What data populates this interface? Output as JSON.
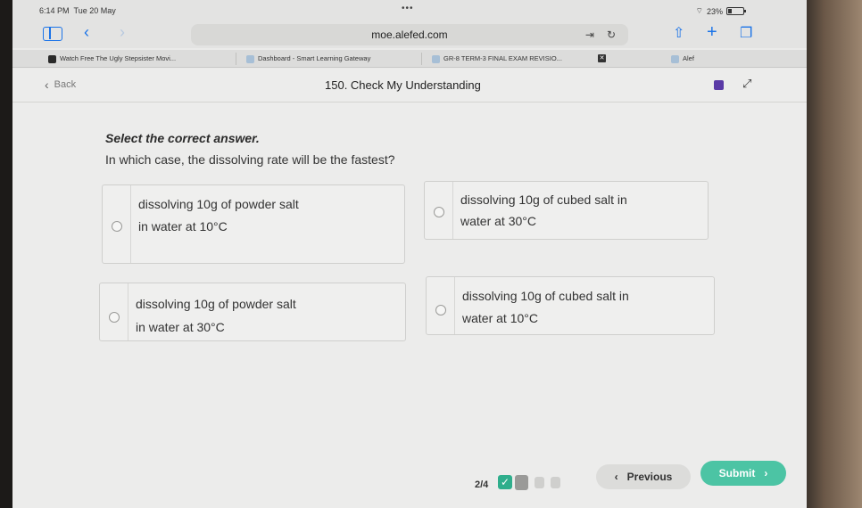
{
  "status_bar": {
    "time": "6:14 PM",
    "date": "Tue 20 May",
    "battery": "23%"
  },
  "browser": {
    "url": "moe.alefed.com",
    "tabs": [
      {
        "label": "Watch Free The Ugly Stepsister Movi..."
      },
      {
        "label": "Dashboard - Smart Learning Gateway"
      },
      {
        "label": "GR-8 TERM-3 FINAL EXAM REVISIO..."
      },
      {
        "label": "Alef"
      }
    ]
  },
  "header": {
    "back_label": "Back",
    "title": "150. Check My Understanding"
  },
  "question": {
    "instruction": "Select the correct answer.",
    "text": "In which case, the dissolving rate will be the fastest?",
    "options": [
      {
        "line1": "dissolving 10g of powder salt",
        "line2": "in water at 10°C"
      },
      {
        "line1": "dissolving 10g of cubed salt in",
        "line2": "water at 30°C"
      },
      {
        "line1": "dissolving 10g of powder salt",
        "line2": "in water at 30°C"
      },
      {
        "line1": "dissolving 10g of cubed salt in",
        "line2": "water at 10°C"
      }
    ]
  },
  "footer": {
    "progress": "2/4",
    "previous_label": "Previous",
    "submit_label": "Submit"
  },
  "colors": {
    "accent": "#4cc4a4",
    "link": "#1a73e8"
  }
}
